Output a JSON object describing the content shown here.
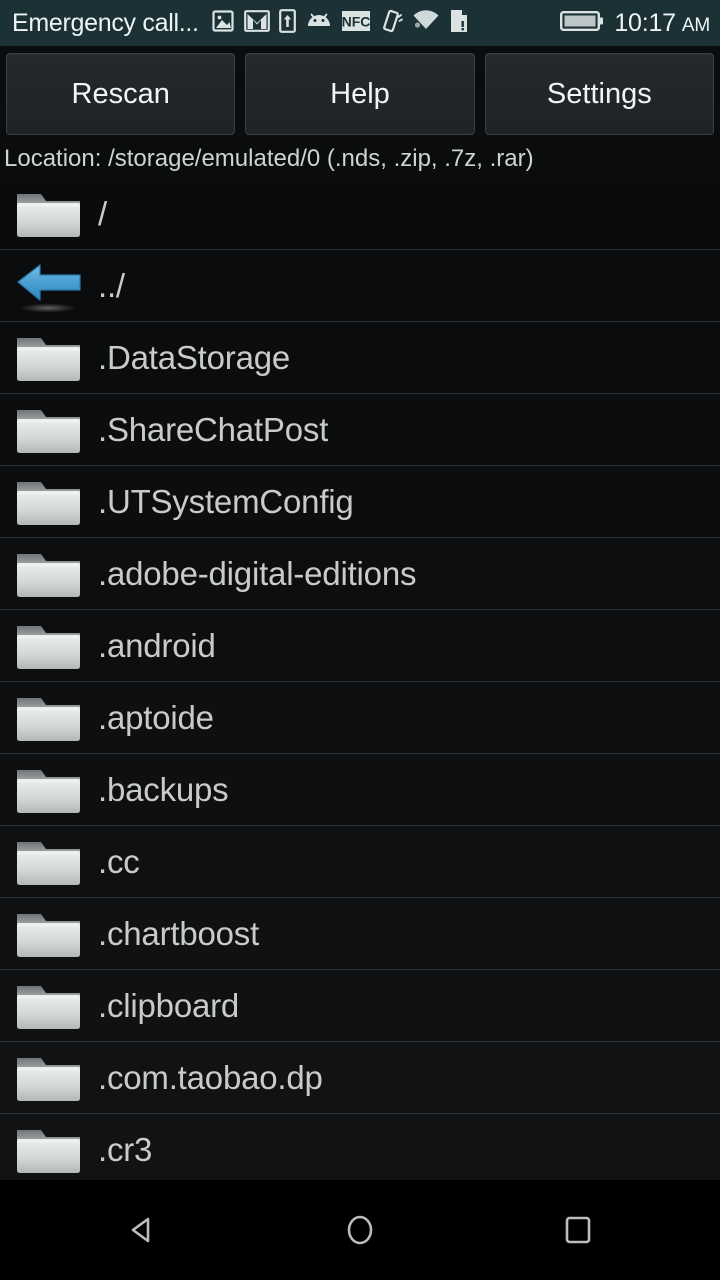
{
  "status_bar": {
    "notification_text": "Emergency call...",
    "clock_time": "10:17",
    "clock_ampm": "AM",
    "background_color": "#1b3136",
    "icons": [
      "photo-icon",
      "gmail-icon",
      "upload-icon",
      "android-icon",
      "nfc-icon",
      "vibrate-icon",
      "wifi-icon",
      "sd-card-alert-icon",
      "battery-icon"
    ]
  },
  "toolbar": {
    "rescan_label": "Rescan",
    "help_label": "Help",
    "settings_label": "Settings"
  },
  "location": {
    "text": "Location: /storage/emulated/0 (.nds, .zip, .7z, .rar)"
  },
  "file_list": {
    "rows": [
      {
        "label": "/",
        "icon": "folder-icon"
      },
      {
        "label": "../",
        "icon": "back-arrow-icon"
      },
      {
        "label": ".DataStorage",
        "icon": "folder-icon"
      },
      {
        "label": ".ShareChatPost",
        "icon": "folder-icon"
      },
      {
        "label": ".UTSystemConfig",
        "icon": "folder-icon"
      },
      {
        "label": ".adobe-digital-editions",
        "icon": "folder-icon"
      },
      {
        "label": ".android",
        "icon": "folder-icon"
      },
      {
        "label": ".aptoide",
        "icon": "folder-icon"
      },
      {
        "label": ".backups",
        "icon": "folder-icon"
      },
      {
        "label": ".cc",
        "icon": "folder-icon"
      },
      {
        "label": ".chartboost",
        "icon": "folder-icon"
      },
      {
        "label": ".clipboard",
        "icon": "folder-icon"
      },
      {
        "label": ".com.taobao.dp",
        "icon": "folder-icon"
      },
      {
        "label": ".cr3",
        "icon": "folder-icon"
      }
    ]
  },
  "nav_bar": {
    "back_label": "back-icon",
    "home_label": "home-icon",
    "recents_label": "recents-icon"
  },
  "colors": {
    "status_bar": "#1b3136",
    "accent_arrow": "#4a9fd2",
    "text_primary": "#c9cbcb",
    "row_divider": "#2b3134"
  }
}
